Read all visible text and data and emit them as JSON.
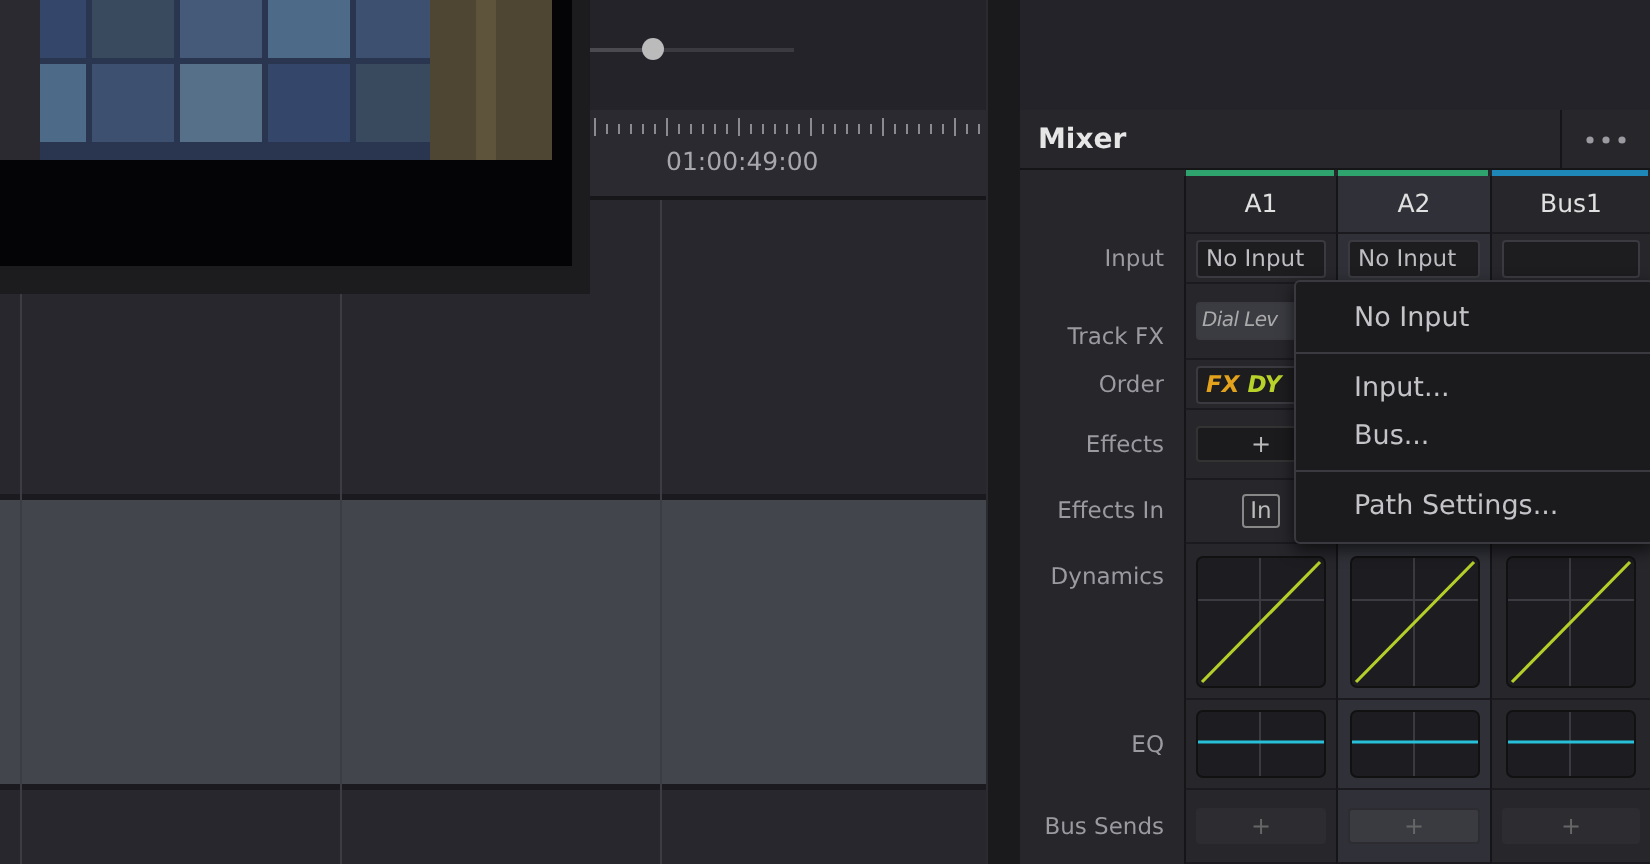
{
  "zoom_slider": {
    "level": 0.3
  },
  "timeline": {
    "timecode": "01:00:49:00"
  },
  "mixer": {
    "title": "Mixer",
    "row_labels": [
      "Input",
      "Track FX",
      "Order",
      "Effects",
      "Effects In",
      "Dynamics",
      "EQ",
      "Bus Sends"
    ],
    "channels": [
      {
        "name": "A1",
        "color": "#2fa36e",
        "selected": false,
        "input": "No Input",
        "track_fx": "Dial Lev",
        "order": [
          {
            "label": "FX",
            "color": "#e2a21c"
          },
          {
            "label": "DY",
            "color": "#b9d22a"
          }
        ],
        "effects": "+",
        "effects_in": "In",
        "bus_send": "+"
      },
      {
        "name": "A2",
        "color": "#2fa36e",
        "selected": true,
        "input": "No Input",
        "bus_send": "+"
      },
      {
        "name": "Bus1",
        "color": "#1f86b8",
        "selected": false,
        "bus_send": "+"
      }
    ]
  },
  "input_menu": {
    "groups": [
      [
        "No Input"
      ],
      [
        "Input...",
        "Bus..."
      ],
      [
        "Path Settings..."
      ]
    ]
  }
}
